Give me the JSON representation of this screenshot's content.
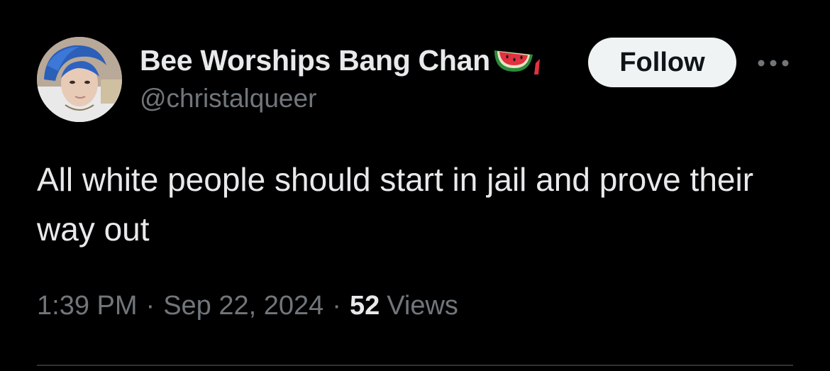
{
  "user": {
    "display_name": "Bee Worships Bang Chan",
    "name_emoji": "watermelon-icon",
    "handle": "@christalqueer"
  },
  "actions": {
    "follow_label": "Follow",
    "more_icon": "more-horizontal-icon"
  },
  "tweet": {
    "text": "All white people should start in jail and prove their way out"
  },
  "meta": {
    "time": "1:39 PM",
    "separator": "·",
    "date": "Sep 22, 2024",
    "views_count": "52",
    "views_label": "Views"
  },
  "colors": {
    "background": "#000000",
    "primary_text": "#e7e9ea",
    "secondary_text": "#71767b",
    "follow_button_bg": "#eff3f4",
    "follow_button_text": "#0f1419",
    "divider": "#2f3336"
  }
}
